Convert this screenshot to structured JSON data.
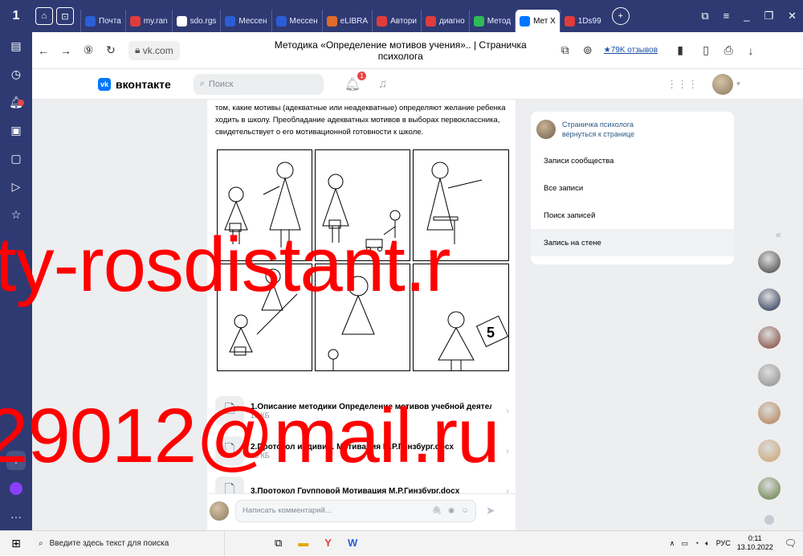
{
  "browser": {
    "tabs": [
      {
        "label": "Почта",
        "color": "#2b5ed6"
      },
      {
        "label": "my.ran",
        "color": "#e03c3c"
      },
      {
        "label": "sdo.rgs",
        "color": "#ffffff"
      },
      {
        "label": "Мессен",
        "color": "#2b5ed6"
      },
      {
        "label": "Мессен",
        "color": "#2b5ed6"
      },
      {
        "label": "eLIBRA",
        "color": "#e06b2c"
      },
      {
        "label": "Автори",
        "color": "#e03c3c"
      },
      {
        "label": "диагно",
        "color": "#e03c3c"
      },
      {
        "label": "Метод",
        "color": "#2dbb55"
      },
      {
        "label": "Мет X",
        "color": "#0077ff",
        "active": true
      },
      {
        "label": "1Ds99",
        "color": "#e03c3c"
      }
    ],
    "user_icon": "1",
    "url": "vk.com",
    "page_title": "Методика «Определение мотивов учения».. | Страничка психолога",
    "reviews": "★79K отзывов"
  },
  "vk": {
    "logo_text": "вконтакте",
    "logo_mark": "vk",
    "search_placeholder": "Поиск",
    "notifications_badge": "1"
  },
  "post": {
    "text": "том, какие мотивы (адекватные или неадекватные) определяют желание ребенка ходить в школу. Преобладание адекватных мотивов в выборах первоклассника, свидетельствует о его мотивационной готовности к школе.",
    "panel_number": "5",
    "files": [
      {
        "name": "1.Описание методики Определение мотивов учебной деятел...",
        "size": "13 КБ"
      },
      {
        "name": "2.Протокол индивид. Мотивация М.Р.Гинзбург.docx",
        "size": "13 КБ"
      },
      {
        "name": "3.Протокол Групповой Мотивация М.Р.Гинзбург.docx",
        "size": ""
      }
    ],
    "comment_placeholder": "Написать комментарий..."
  },
  "sidebar_card": {
    "name": "Страничка психолога",
    "back": "вернуться к странице",
    "items": [
      {
        "label": "Записи сообщества",
        "selected": false
      },
      {
        "label": "Все записи",
        "selected": false
      },
      {
        "label": "Поиск записей",
        "selected": false
      },
      {
        "label": "Запись на стене",
        "selected": true
      }
    ]
  },
  "watermark": {
    "line1": "ty-rosdistant.r",
    "line2": "29012@mail.ru"
  },
  "taskbar": {
    "search_placeholder": "Введите здесь текст для поиска",
    "lang": "РУС",
    "time": "0:11",
    "date": "13.10.2022"
  }
}
